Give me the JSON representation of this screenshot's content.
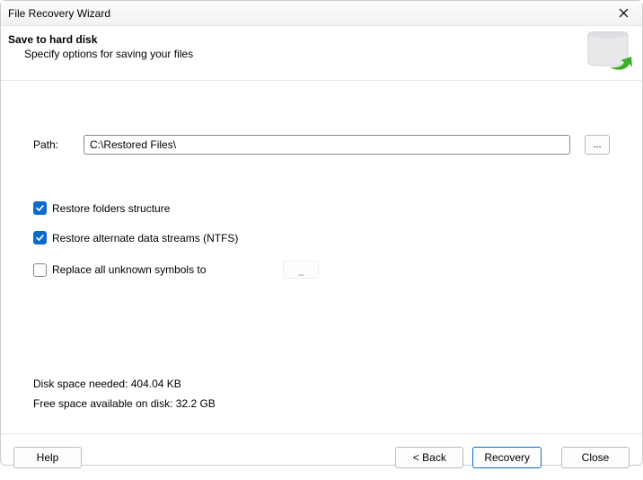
{
  "titlebar": {
    "title": "File Recovery Wizard"
  },
  "header": {
    "title": "Save to hard disk",
    "subtitle": "Specify options for saving your files"
  },
  "path": {
    "label": "Path:",
    "value": "C:\\Restored Files\\",
    "browse": "..."
  },
  "options": {
    "restore_folders": {
      "label": "Restore folders structure",
      "checked": true
    },
    "restore_streams": {
      "label": "Restore alternate data streams (NTFS)",
      "checked": true
    },
    "replace_symbols": {
      "label": "Replace all unknown symbols to",
      "checked": false,
      "value": "_"
    }
  },
  "diskinfo": {
    "needed_label": "Disk space needed:",
    "needed_value": "404.04 KB",
    "free_label": "Free space available on disk:",
    "free_value": "32.2 GB"
  },
  "footer": {
    "help": "Help",
    "back": "< Back",
    "recovery": "Recovery",
    "close": "Close"
  }
}
